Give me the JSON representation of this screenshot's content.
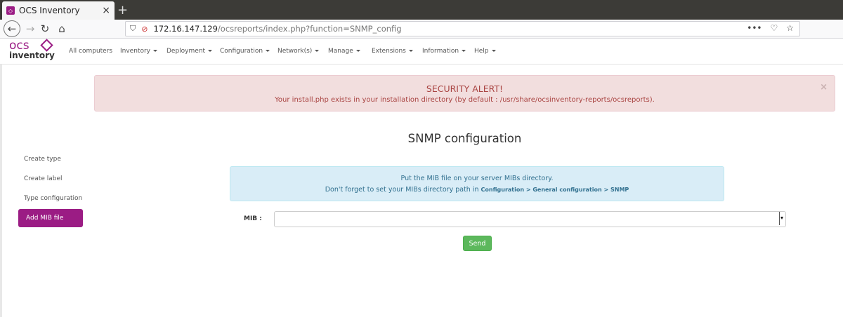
{
  "browser": {
    "tab_title": "OCS Inventory",
    "tab_close": "×",
    "new_tab": "+",
    "url_host": "172.16.147.129",
    "url_path": "/ocsreports/index.php?function=SNMP_config",
    "url_actions": "•••"
  },
  "app": {
    "logo_top": "ocs",
    "logo_bottom": "inventory",
    "menu": [
      {
        "label": "All computers",
        "dropdown": false
      },
      {
        "label": "Inventory",
        "dropdown": true
      },
      {
        "label": "Deployment",
        "dropdown": true
      },
      {
        "label": "Configuration",
        "dropdown": true
      },
      {
        "label": "Network(s)",
        "dropdown": true
      },
      {
        "label": "Manage",
        "dropdown": true
      },
      {
        "label": "Extensions",
        "dropdown": true
      },
      {
        "label": "Information",
        "dropdown": true
      },
      {
        "label": "Help",
        "dropdown": true
      }
    ]
  },
  "sidebar": {
    "items": [
      "Create type",
      "Create label",
      "Type configuration"
    ],
    "active_item": "Add MIB file"
  },
  "alert": {
    "title": "SECURITY ALERT!",
    "text": "Your install.php exists in your installation directory (by default : /usr/share/ocsinventory-reports/ocsreports).",
    "close": "×"
  },
  "page": {
    "title": "SNMP configuration"
  },
  "info": {
    "line1": "Put the MIB file on your server MIBs directory.",
    "line2_prefix": "Don't forget to set your MIBs directory path in ",
    "line2_path": "Configuration > General configuration > SNMP"
  },
  "form": {
    "mib_label": "MIB :",
    "mib_value": "",
    "send_label": "Send"
  },
  "colors": {
    "brand": "#9b1c84",
    "alert_bg": "#f2dede",
    "info_bg": "#d9edf7",
    "send_bg": "#5cb85c"
  }
}
